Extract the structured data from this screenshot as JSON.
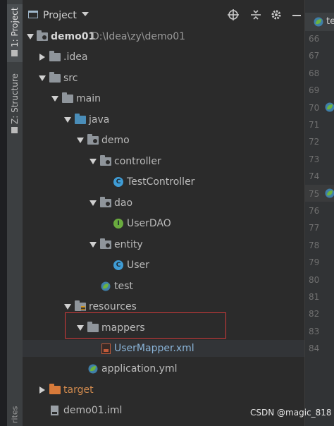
{
  "sidebar_strip": {
    "project_tab": "1: Project",
    "structure_tab": "Z: Structure",
    "favorites_tab": "rites"
  },
  "panel": {
    "title": "Project",
    "buttons": [
      "crosshair-icon",
      "collapse-icon",
      "gear-icon",
      "minimize-icon"
    ]
  },
  "tree": [
    {
      "label": "demo01",
      "path": "D:\\Idea\\zy\\demo01",
      "icon": "module-folder-icon",
      "expanded": true
    },
    {
      "label": ".idea",
      "icon": "folder-icon",
      "expanded": false
    },
    {
      "label": "src",
      "icon": "folder-icon",
      "expanded": true
    },
    {
      "label": "main",
      "icon": "folder-icon",
      "expanded": true
    },
    {
      "label": "java",
      "icon": "source-folder-icon",
      "expanded": true
    },
    {
      "label": "demo",
      "icon": "package-icon",
      "expanded": true
    },
    {
      "label": "controller",
      "icon": "package-icon",
      "expanded": true
    },
    {
      "label": "TestController",
      "icon": "class-icon"
    },
    {
      "label": "dao",
      "icon": "package-icon",
      "expanded": true
    },
    {
      "label": "UserDAO",
      "icon": "interface-icon"
    },
    {
      "label": "entity",
      "icon": "package-icon",
      "expanded": true
    },
    {
      "label": "User",
      "icon": "class-icon"
    },
    {
      "label": "test",
      "icon": "spring-test-icon"
    },
    {
      "label": "resources",
      "icon": "resources-folder-icon",
      "expanded": true
    },
    {
      "label": "mappers",
      "icon": "folder-icon",
      "expanded": true
    },
    {
      "label": "UserMapper.xml",
      "icon": "xml-file-icon"
    },
    {
      "label": "application.yml",
      "icon": "spring-yml-icon"
    },
    {
      "label": "target",
      "icon": "excluded-folder-icon",
      "expanded": false
    },
    {
      "label": "demo01.iml",
      "icon": "iml-file-icon"
    }
  ],
  "editor": {
    "tab_label": "te",
    "line_numbers": [
      "66",
      "67",
      "68",
      "69",
      "70",
      "71",
      "72",
      "73",
      "74",
      "75",
      "76",
      "77",
      "78",
      "79",
      "80",
      "81",
      "82",
      "83",
      "84"
    ]
  },
  "watermark": "CSDN @magic_818",
  "colors": {
    "background": "#2b2b2b",
    "highlight_box": "#d23a3a",
    "class_icon": "#3f9cd5",
    "interface_icon": "#6aab3e",
    "excluded_folder": "#d77a3a"
  }
}
